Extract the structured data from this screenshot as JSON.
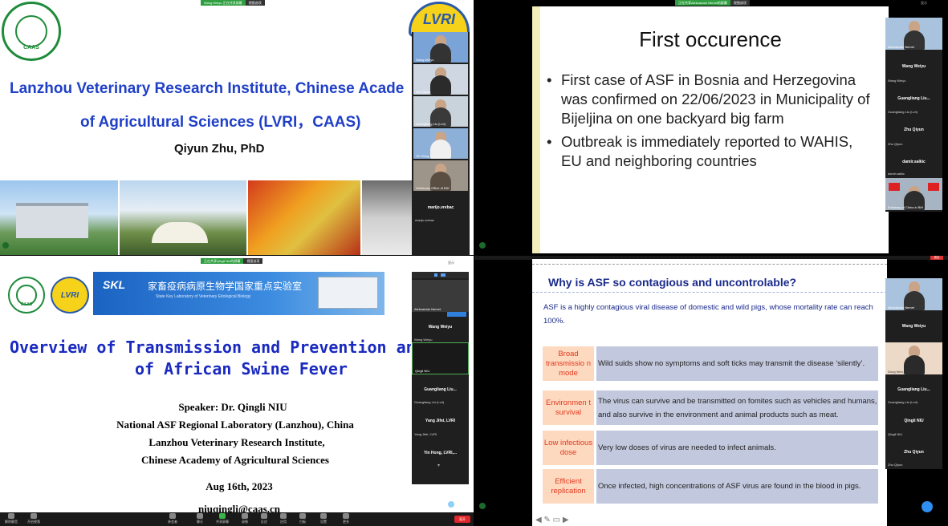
{
  "q1": {
    "banner": {
      "share": "Wang Weiyu 正在共享屏幕",
      "view": "视图选项"
    },
    "logo_text": "CAAS",
    "lvri_logo": "LVRI",
    "title_line1": "Lanzhou Veterinary Research Institute, Chinese Acade",
    "title_line2": "of Agricultural Sciences (LVRI，CAAS)",
    "presenter": "Qiyun Zhu, PhD",
    "participants": [
      {
        "name": "Wang Weiyu"
      },
      {
        "name": "Zhu Qiyun"
      },
      {
        "name": "Guangliang Liu (Lvri)"
      },
      {
        "name": "Yin Hong"
      },
      {
        "name": "Veterinary Office of BiH"
      }
    ],
    "name_tile": "marijo.vrebac",
    "name_tile_label": "marijo.vrebac"
  },
  "q2": {
    "banner": {
      "share": "正在共享Aleksandar Nemet的屏幕",
      "view": "视图选项"
    },
    "top_right": "显示",
    "slide_title": "First occurence",
    "bullets": [
      "First case of ASF in Bosnia and Herzegovina was confirmed on 22/06/2023 in Municipality of Bijeljina on one backyard big farm",
      "Outbreak is immediately reported to WAHIS, EU and neighboring countries"
    ],
    "participants": [
      {
        "video_label": "Aleksandar Nemet",
        "name": "Wang Weiyu",
        "label": "Wang Weiyu"
      },
      {
        "name": "Guangliang Liu...",
        "label": "Guangliang Liu (Lvri)"
      },
      {
        "name": "Zhu Qiyun",
        "label": "Zhu Qiyun"
      },
      {
        "name": "damir.salkic",
        "label": "damir.salkic"
      },
      {
        "video_label": "Embassy of China in BiH"
      }
    ]
  },
  "q3": {
    "banner": {
      "share": "正在共享Qingli Niu的屏幕",
      "view": "视图选项"
    },
    "top_right": "显示",
    "caas_text": "CAAS",
    "lvri_logo": "LVRI",
    "skl_name": "家畜疫病病原生物学国家重点实验室",
    "skl_en": "State Key Laboratory of Veterinary Etiological Biology",
    "title_line1": "Overview of Transmission and Prevention and C",
    "title_line2": "of African Swine Fever",
    "speaker": "Speaker:  Dr. Qingli NIU",
    "affiliation1": "National ASF Regional Laboratory (Lanzhou), China",
    "affiliation2": "Lanzhou Veterinary Research Institute,",
    "affiliation3": "Chinese Academy of Agricultural Sciences",
    "date": "Aug 16th, 2023",
    "email": "niuqingli@caas.cn",
    "panel": [
      {
        "video_label": "Aleksandar Nemet",
        "name": "Wang Weiyu",
        "label": "Wang Weiyu"
      },
      {
        "video_label": "Qingli NIU"
      },
      {
        "name": "Guangliang Liu...",
        "label": "Guangliang Liu (Lvri)"
      },
      {
        "name": "Yang Jifei, LVRI",
        "label": "Yang Jifei, LVRI"
      },
      {
        "name": "Yin Hong, LVRI,..."
      }
    ],
    "taskbar": [
      "解除静音",
      "开启视频",
      "参会者",
      "聊天",
      "共享屏幕",
      "录制",
      "反应",
      "应用",
      "白板",
      "设置",
      "更多"
    ],
    "end_button": "离开"
  },
  "q4": {
    "top_right": "退出",
    "slide_title": "Why is ASF so contagious and uncontrolable?",
    "intro": "ASF is a highly contagious viral disease of domestic and wild pigs, whose mortality rate can reach 100%.",
    "rows": [
      {
        "label": "Broad transmissio n mode",
        "text": "Wild suids show no symptoms and soft ticks may transmit the disease ‘silently’."
      },
      {
        "label": "Environmen t survival",
        "text": "The virus can survive and be transmitted on fomites such as vehicles and humans, and also survive in the environment and animal products such as meat."
      },
      {
        "label": "Low infectious dose",
        "text": "Very low doses of virus are needed to infect animals."
      },
      {
        "label": "Efficient replication",
        "text": "Once infected, high concentrations of ASF virus are found in the blood in pigs."
      }
    ],
    "participants": [
      {
        "video_label": "Aleksandar Nemet",
        "name": "Wang Weiyu"
      },
      {
        "video_label": "Dong Wen, LVRI"
      },
      {
        "name": "Guangliang Liu...",
        "label": "Guangliang Liu (Lvri)"
      },
      {
        "name": "Qingli NIU",
        "label": "Qingli NIU"
      },
      {
        "name": "Zhu Qiyun",
        "label": "Zhu Qiyun"
      }
    ]
  }
}
